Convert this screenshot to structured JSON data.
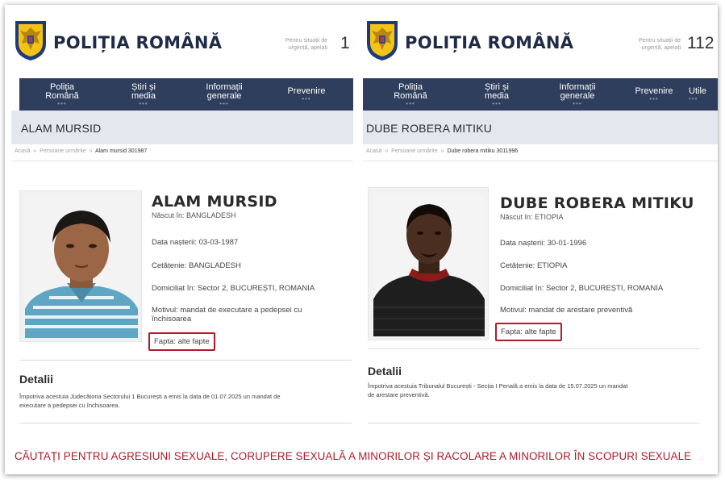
{
  "site_name": "POLIȚIA ROMÂNĂ",
  "nav": [
    {
      "line1": "Poliția",
      "line2": "Română"
    },
    {
      "line1": "Știri și",
      "line2": "media"
    },
    {
      "line1": "Informații",
      "line2": "generale"
    },
    {
      "line1": "Prevenire",
      "line2": ""
    }
  ],
  "nav_extra": "Utile",
  "nav_dots": "•••",
  "emergency": {
    "left_number": "1",
    "right_number": "112",
    "label_line1": "Pentru situații de",
    "label_line2": "urgență, apelați"
  },
  "left": {
    "page_title": "ALAM MURSID",
    "breadcrumb_home": "Acasă",
    "breadcrumb_section": "Persoane urmărite",
    "breadcrumb_current": "Alam mursid 301987",
    "sep": "»",
    "name": "ALAM MURSID",
    "born_in": "Născut în: BANGLADESH",
    "birth_date": "Data nașterii: 03-03-1987",
    "citizenship": "Cetățenie: BANGLADESH",
    "domicile": "Domiciliat în: Sector 2, BUCUREȘTI, ROMANIA",
    "reason_line1": "Motivul: mandat de executare a pedepsei cu",
    "reason_line2": "închisoarea",
    "deed": "Fapta: alte fapte",
    "details_heading": "Detalii",
    "details_line1": "Împotriva acestuia Judecătoria Sectorului 1 București a emis la data de 01.07.2025 un mandat de",
    "details_line2": "executare a pedepsei cu închisoarea."
  },
  "right": {
    "page_title": "DUBE ROBERA MITIKU",
    "breadcrumb_home": "Acasă",
    "breadcrumb_section": "Persoane urmărite",
    "breadcrumb_current": "Dube robera mitiku 3011996",
    "sep": "»",
    "name": "DUBE ROBERA MITIKU",
    "born_in": "Născut în: ETIOPIA",
    "birth_date": "Data nașterii: 30-01-1996",
    "citizenship": "Cetățenie: ETIOPIA",
    "domicile": "Domiciliat în: Sector 2, BUCUREȘTI, ROMANIA",
    "reason": "Motivul: mandat de arestare preventivă",
    "deed": "Fapta: alte fapte",
    "details_heading": "Detalii",
    "details_line1": "Împotriva acestuia Tribunalul București - Secția I Penală a emis la data de 15.07.2025 un mandat",
    "details_line2": "de arestare preventivă."
  },
  "banner_text": "CĂUTAȚI PENTRU AGRESIUNI SEXUALE, CORUPERE SEXUALĂ A MINORILOR ȘI RACOLARE A MINORILOR ÎN SCOPURI SEXUALE",
  "colors": {
    "nav": "#2e3e5c",
    "highlight": "#b01a2a",
    "brand": "#1f2b47",
    "title_band": "#e4e8ee"
  },
  "icons": {
    "crest": "romanian-police-crest-icon"
  }
}
